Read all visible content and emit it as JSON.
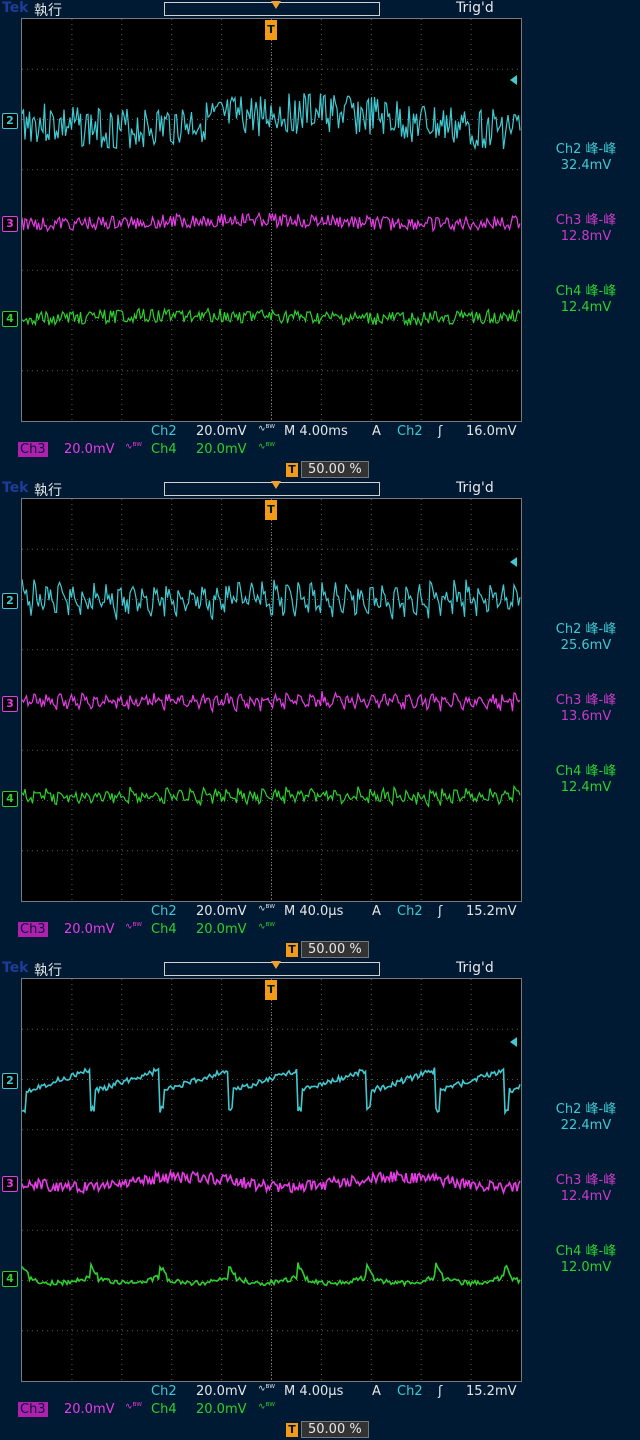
{
  "colors": {
    "ch2": "#41c9d2",
    "ch3": "#e63ce6",
    "ch4": "#2ed02e",
    "trigger": "#f39a18"
  },
  "panels": [
    {
      "brand": "Tek",
      "mode": "執行",
      "trig_status": "Trig'd",
      "t_marker": "T",
      "ch_markers": [
        "2",
        "3",
        "4"
      ],
      "measurements": [
        {
          "label": "Ch2 峰-峰",
          "value": "32.4mV"
        },
        {
          "label": "Ch3 峰-峰",
          "value": "12.8mV"
        },
        {
          "label": "Ch4 峰-峰",
          "value": "12.4mV"
        }
      ],
      "status": {
        "ch2": "Ch2",
        "ch2_scale": "20.0mV",
        "bw": "∿ᴮᵂ",
        "timebase": "M 4.00ms",
        "acq": "A",
        "trig_src": "Ch2",
        "trig_slope": "ʃ",
        "trig_level": "16.0mV",
        "ch3": "Ch3",
        "ch3_scale": "20.0mV",
        "ch4": "Ch4",
        "ch4_scale": "20.0mV",
        "trig_pos": "50.00 %"
      }
    },
    {
      "brand": "Tek",
      "mode": "執行",
      "trig_status": "Trig'd",
      "t_marker": "T",
      "ch_markers": [
        "2",
        "3",
        "4"
      ],
      "measurements": [
        {
          "label": "Ch2 峰-峰",
          "value": "25.6mV"
        },
        {
          "label": "Ch3 峰-峰",
          "value": "13.6mV"
        },
        {
          "label": "Ch4 峰-峰",
          "value": "12.4mV"
        }
      ],
      "status": {
        "ch2": "Ch2",
        "ch2_scale": "20.0mV",
        "bw": "∿ᴮᵂ",
        "timebase": "M 40.0µs",
        "acq": "A",
        "trig_src": "Ch2",
        "trig_slope": "ʃ",
        "trig_level": "15.2mV",
        "ch3": "Ch3",
        "ch3_scale": "20.0mV",
        "ch4": "Ch4",
        "ch4_scale": "20.0mV",
        "trig_pos": "50.00 %"
      }
    },
    {
      "brand": "Tek",
      "mode": "執行",
      "trig_status": "Trig'd",
      "t_marker": "T",
      "ch_markers": [
        "2",
        "3",
        "4"
      ],
      "measurements": [
        {
          "label": "Ch2 峰-峰",
          "value": "22.4mV"
        },
        {
          "label": "Ch3 峰-峰",
          "value": "12.4mV"
        },
        {
          "label": "Ch4 峰-峰",
          "value": "12.0mV"
        }
      ],
      "status": {
        "ch2": "Ch2",
        "ch2_scale": "20.0mV",
        "bw": "∿ᴮᵂ",
        "timebase": "M 4.00µs",
        "acq": "A",
        "trig_src": "Ch2",
        "trig_slope": "ʃ",
        "trig_level": "15.2mV",
        "ch3": "Ch3",
        "ch3_scale": "20.0mV",
        "ch4": "Ch4",
        "ch4_scale": "20.0mV",
        "trig_pos": "50.00 %"
      }
    }
  ]
}
